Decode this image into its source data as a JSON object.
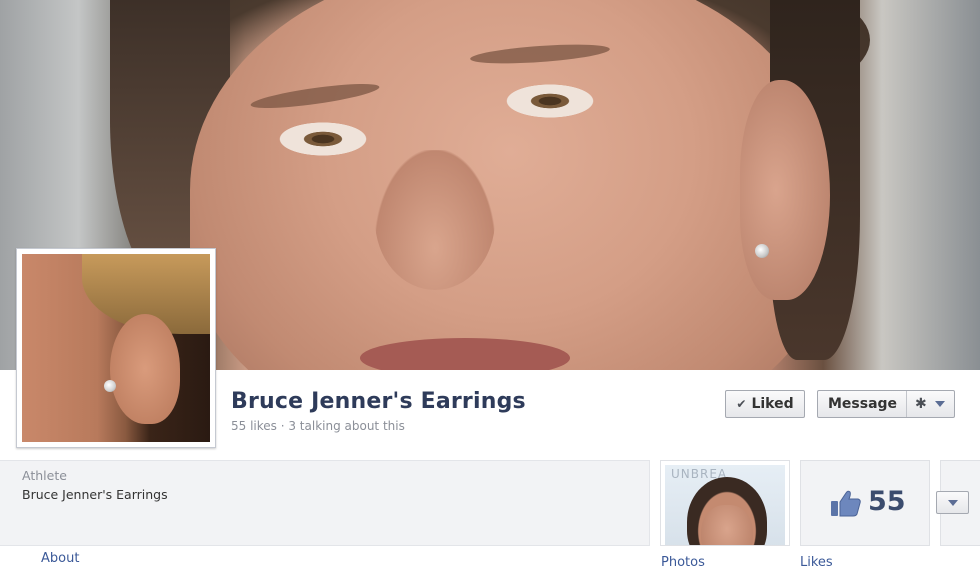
{
  "header": {
    "page_name": "Bruce Jenner's Earrings",
    "stats": "55 likes · 3 talking about this"
  },
  "actions": {
    "liked_label": "Liked",
    "message_label": "Message"
  },
  "about": {
    "category": "Athlete",
    "description": "Bruce Jenner's Earrings",
    "link_label": "About"
  },
  "tiles": {
    "photos_label": "Photos",
    "photo_bg_text": "UNBREA",
    "likes_label": "Likes",
    "likes_count": "55"
  },
  "icons": {
    "liked": "check-icon",
    "settings": "gear-icon",
    "dropdown": "chevron-down-icon",
    "likes": "thumbs-up-icon"
  },
  "colors": {
    "link": "#3b5998",
    "page_name": "#2e3b5a",
    "muted_text": "#8b8f98"
  }
}
